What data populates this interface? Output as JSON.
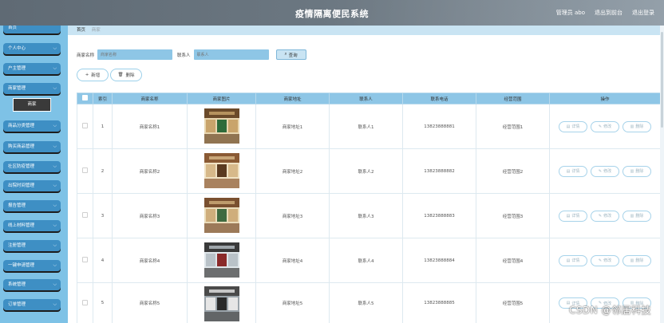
{
  "header": {
    "title": "疫情隔离便民系统",
    "user_label": "管理员 abo",
    "backend_link": "退出到前台",
    "logout_link": "退出登录"
  },
  "sidebar": {
    "top_item": "首页",
    "items": [
      {
        "label": "个人中心"
      },
      {
        "label": "户主管理"
      },
      {
        "label": "商家管理"
      },
      {
        "label": "商品分类管理"
      },
      {
        "label": "购买商品管理"
      },
      {
        "label": "社区防疫管理"
      },
      {
        "label": "出院时间管理"
      },
      {
        "label": "报告管理"
      },
      {
        "label": "线上材料管理"
      },
      {
        "label": "注册管理"
      },
      {
        "label": "一键申请管理"
      },
      {
        "label": "系统管理"
      },
      {
        "label": "订单管理"
      }
    ],
    "active_sub": "商家"
  },
  "breadcrumb": {
    "home": "首页",
    "current": "商家"
  },
  "search": {
    "name_label": "商家名称",
    "name_placeholder": "商家名称",
    "contact_label": "联系人",
    "contact_placeholder": "联系人",
    "query_button": "查询"
  },
  "actions": {
    "add": "新增",
    "delete": "删除"
  },
  "table": {
    "headers": [
      "索引",
      "商家名称",
      "商家图片",
      "商家地址",
      "联系人",
      "联系电话",
      "经营范围",
      "操作"
    ],
    "rows": [
      {
        "index": "1",
        "name": "商家名称1",
        "address": "商家地址1",
        "contact": "联系人1",
        "phone": "13823888881",
        "scope": "经营范围1"
      },
      {
        "index": "2",
        "name": "商家名称2",
        "address": "商家地址2",
        "contact": "联系人2",
        "phone": "13823888882",
        "scope": "经营范围2"
      },
      {
        "index": "3",
        "name": "商家名称3",
        "address": "商家地址3",
        "contact": "联系人3",
        "phone": "13823888883",
        "scope": "经营范围3"
      },
      {
        "index": "4",
        "name": "商家名称4",
        "address": "商家地址4",
        "contact": "联系人4",
        "phone": "13823888884",
        "scope": "经营范围4"
      },
      {
        "index": "5",
        "name": "商家名称5",
        "address": "商家地址5",
        "contact": "联系人5",
        "phone": "13823888885",
        "scope": "经营范围5"
      }
    ],
    "op_labels": {
      "detail": "详情",
      "edit": "修改",
      "delete": "删除"
    }
  },
  "icons": {
    "chevron": "chevron-down-icon",
    "search": "search-icon",
    "plus": "plus-icon",
    "trash": "trash-icon",
    "doc": "document-icon",
    "pencil": "pencil-icon"
  },
  "watermark": "CSDN @邻居科技",
  "colors": {
    "header": "#6d7983",
    "sidebar": "#7ec2e6",
    "menu_item": "#3e8fc4",
    "table_header": "#8ec6e6",
    "breadcrumb": "#c9e4f3"
  }
}
